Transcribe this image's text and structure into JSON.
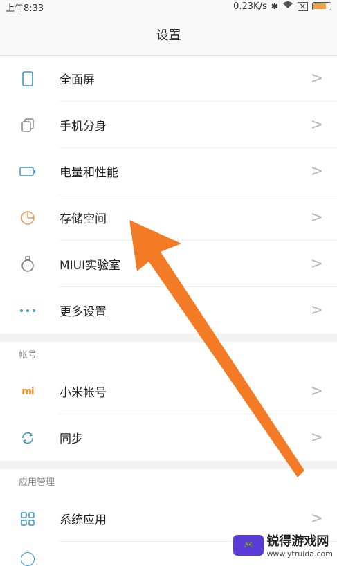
{
  "status": {
    "time": "上午8:33",
    "speed": "0.23K/s"
  },
  "title": "设置",
  "items_top": [
    {
      "label": "全面屏",
      "icon": "phone-icon"
    },
    {
      "label": "手机分身",
      "icon": "clone-icon"
    },
    {
      "label": "电量和性能",
      "icon": "battery-icon"
    },
    {
      "label": "存储空间",
      "icon": "storage-pie-icon"
    },
    {
      "label": "MIUI实验室",
      "icon": "flask-icon"
    },
    {
      "label": "更多设置",
      "icon": "more-dots-icon"
    }
  ],
  "section_account": {
    "title": "帐号",
    "items": [
      {
        "label": "小米帐号",
        "icon": "mi-logo-icon"
      },
      {
        "label": "同步",
        "icon": "sync-icon"
      }
    ]
  },
  "section_apps": {
    "title": "应用管理",
    "items": [
      {
        "label": "系统应用",
        "icon": "grid-apps-icon"
      }
    ]
  },
  "chevron": ">",
  "watermark": {
    "name": "锐得游戏网",
    "url": "www.ytruida.com"
  },
  "colors": {
    "accent_icon": "#3a9bbf",
    "storage_icon": "#e0a060",
    "mi_logo": "#f09020",
    "arrow": "#f47b26"
  }
}
